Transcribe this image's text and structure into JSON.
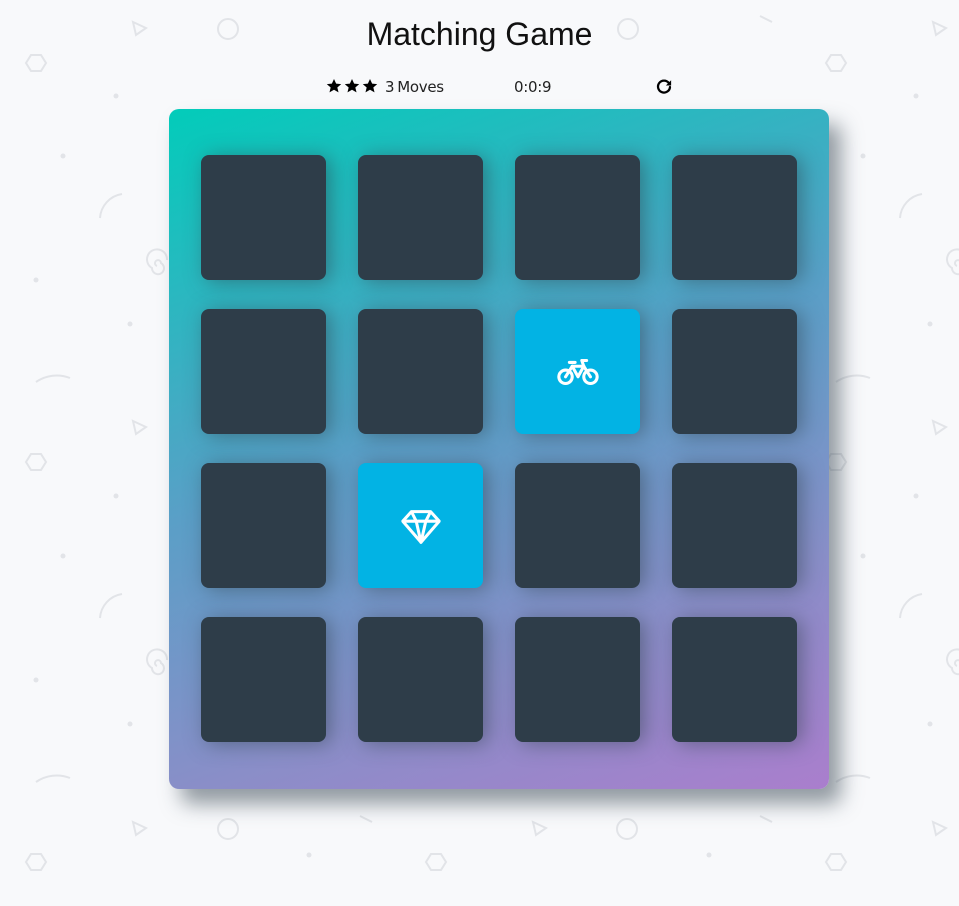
{
  "game": {
    "title": "Matching Game"
  },
  "score_panel": {
    "stars_earned": 3,
    "stars_total": 3,
    "moves_count": "3",
    "moves_label": "Moves",
    "timer": "0:0:9",
    "restart_icon": "restart-icon"
  },
  "deck": {
    "rows": 4,
    "columns": 4,
    "cards": [
      {
        "state": "closed",
        "icon": ""
      },
      {
        "state": "closed",
        "icon": ""
      },
      {
        "state": "closed",
        "icon": ""
      },
      {
        "state": "closed",
        "icon": ""
      },
      {
        "state": "closed",
        "icon": ""
      },
      {
        "state": "closed",
        "icon": ""
      },
      {
        "state": "open",
        "icon": "bicycle-icon"
      },
      {
        "state": "closed",
        "icon": ""
      },
      {
        "state": "closed",
        "icon": ""
      },
      {
        "state": "open",
        "icon": "diamond-icon"
      },
      {
        "state": "closed",
        "icon": ""
      },
      {
        "state": "closed",
        "icon": ""
      },
      {
        "state": "closed",
        "icon": ""
      },
      {
        "state": "closed",
        "icon": ""
      },
      {
        "state": "closed",
        "icon": ""
      },
      {
        "state": "closed",
        "icon": ""
      }
    ]
  },
  "colors": {
    "card_closed": "#2e3d49",
    "card_open": "#02b3e4",
    "deck_gradient_start": "#02ccba",
    "deck_gradient_end": "#aa7ecd",
    "background": "#f8f9fb"
  }
}
